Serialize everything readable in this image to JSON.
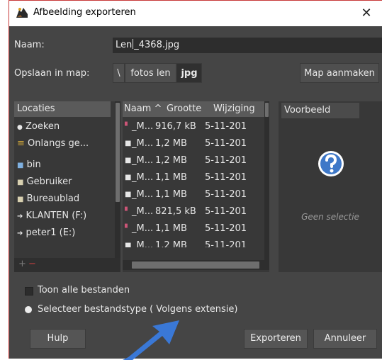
{
  "window": {
    "title": "Afbeelding exporteren",
    "close_glyph": "✕"
  },
  "name_row": {
    "label": "Naam:",
    "value_before_caret": "Len",
    "value_after_caret": "_4368.jpg"
  },
  "folder_row": {
    "label": "Opslaan in map:",
    "path_buttons": [
      "\\",
      "fotos len",
      "jpg"
    ],
    "create_folder": "Map aanmaken"
  },
  "places": {
    "header": "Locaties",
    "items": [
      {
        "icon": "search-icon",
        "glyph": "🔍",
        "label": "Zoeken"
      },
      {
        "icon": "recent-icon",
        "glyph": "≡",
        "label": "Onlangs ge..."
      },
      {
        "icon": "folder-icon",
        "glyph": "■",
        "label": "bin"
      },
      {
        "icon": "folder-icon",
        "glyph": "■",
        "label": "Gebruiker"
      },
      {
        "icon": "folder-icon",
        "glyph": "■",
        "label": "Bureaublad"
      },
      {
        "icon": "drive-icon",
        "glyph": "⇨",
        "label": "KLANTEN (F:)"
      },
      {
        "icon": "drive-icon",
        "glyph": "⇨",
        "label": "peter1 (E:)"
      }
    ],
    "add": "+",
    "remove": "−"
  },
  "files": {
    "columns": [
      "Naam ^",
      "Grootte",
      "Wijziging"
    ],
    "rows": [
      {
        "name": "_M...",
        "size": "916,7 kB",
        "date": "5-11-201"
      },
      {
        "name": "_M...",
        "size": "1,2 MB",
        "date": "5-11-201"
      },
      {
        "name": "_M...",
        "size": "1,2 MB",
        "date": "5-11-201"
      },
      {
        "name": "_M...",
        "size": "1,1 MB",
        "date": "5-11-201"
      },
      {
        "name": "_M...",
        "size": "1,1 MB",
        "date": "5-11-201"
      },
      {
        "name": "_M...",
        "size": "821,5 kB",
        "date": "5-11-201"
      },
      {
        "name": "_M...",
        "size": "1,1 MB",
        "date": "5-11-201"
      },
      {
        "name": "_M...",
        "size": "1,2 MB",
        "date": "5-11-201"
      }
    ]
  },
  "preview": {
    "header": "Voorbeeld",
    "none": "Geen selectie",
    "accent": "#ffffff"
  },
  "options": {
    "show_all": "Toon alle bestanden",
    "select_type": "Selecteer bestandstype ( Volgens extensie)"
  },
  "buttons": {
    "help": "Hulp",
    "export": "Exporteren",
    "cancel": "Annuleer"
  },
  "annotation": {
    "arrow_color": "#3a78d6"
  }
}
